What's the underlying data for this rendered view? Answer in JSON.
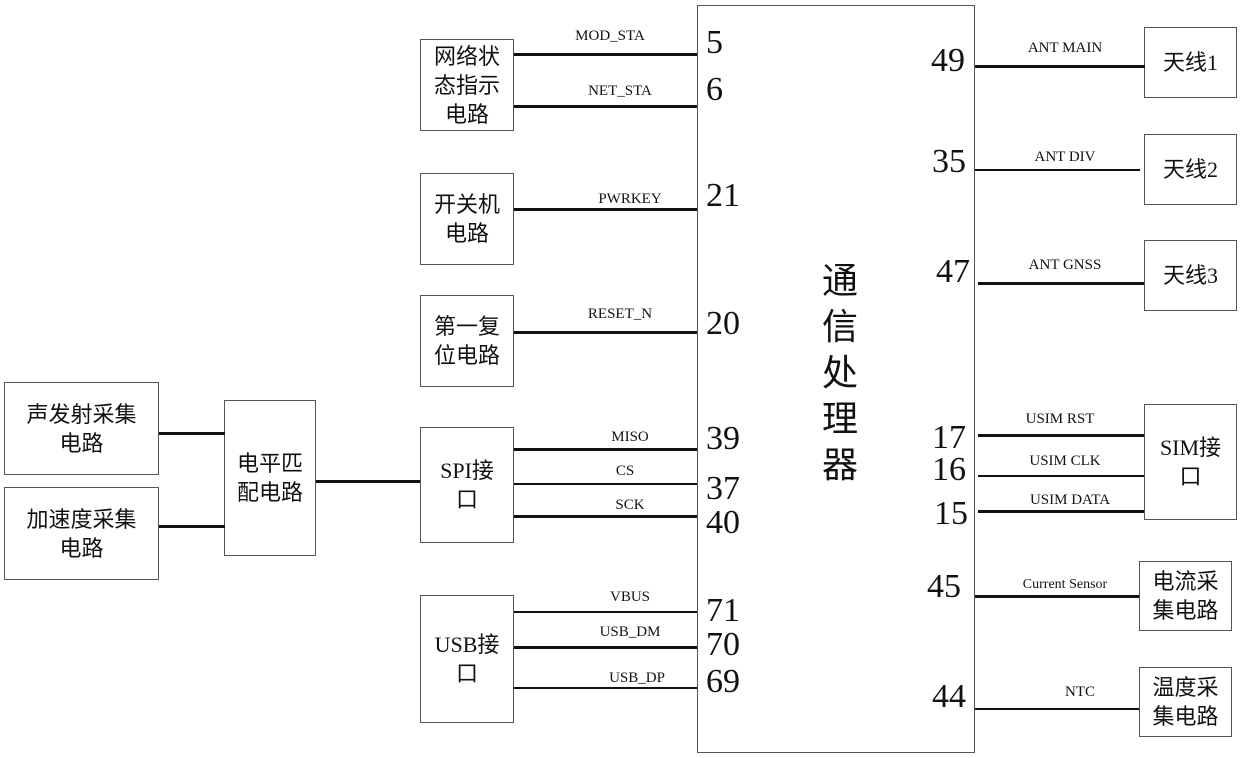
{
  "processor": {
    "label": "通\n信\n处\n理\n器"
  },
  "left_blocks": {
    "net_status": {
      "label": "网络状\n态指示\n电路"
    },
    "power_switch": {
      "label": "开关机\n电路"
    },
    "reset": {
      "label": "第一复\n位电路"
    },
    "spi": {
      "label": "SPI接\n口"
    },
    "usb": {
      "label": "USB接\n口"
    },
    "level_match": {
      "label": "电平匹\n配电路"
    },
    "acoustic": {
      "label": "声发射采集\n电路"
    },
    "accel": {
      "label": "加速度采集\n电路"
    }
  },
  "right_blocks": {
    "ant1": {
      "label": "天线1"
    },
    "ant2": {
      "label": "天线2"
    },
    "ant3": {
      "label": "天线3"
    },
    "sim": {
      "label": "SIM接\n口"
    },
    "current": {
      "label": "电流采\n集电路"
    },
    "temp": {
      "label": "温度采\n集电路"
    }
  },
  "signals_left": [
    {
      "name": "MOD_STA",
      "pin": "5"
    },
    {
      "name": "NET_STA",
      "pin": "6"
    },
    {
      "name": "PWRKEY",
      "pin": "21"
    },
    {
      "name": "RESET_N",
      "pin": "20"
    },
    {
      "name": "MISO",
      "pin": "39"
    },
    {
      "name": "CS",
      "pin": "37"
    },
    {
      "name": "SCK",
      "pin": "40"
    },
    {
      "name": "VBUS",
      "pin": "71"
    },
    {
      "name": "USB_DM",
      "pin": "70"
    },
    {
      "name": "USB_DP",
      "pin": "69"
    }
  ],
  "signals_right": [
    {
      "name": "ANT MAIN",
      "pin": "49"
    },
    {
      "name": "ANT DIV",
      "pin": "35"
    },
    {
      "name": "ANT GNSS",
      "pin": "47"
    },
    {
      "name": "USIM RST",
      "pin": "17"
    },
    {
      "name": "USIM CLK",
      "pin": "16"
    },
    {
      "name": "USIM DATA",
      "pin": "15"
    },
    {
      "name": "Current Sensor",
      "pin": "45"
    },
    {
      "name": "NTC",
      "pin": "44"
    }
  ]
}
